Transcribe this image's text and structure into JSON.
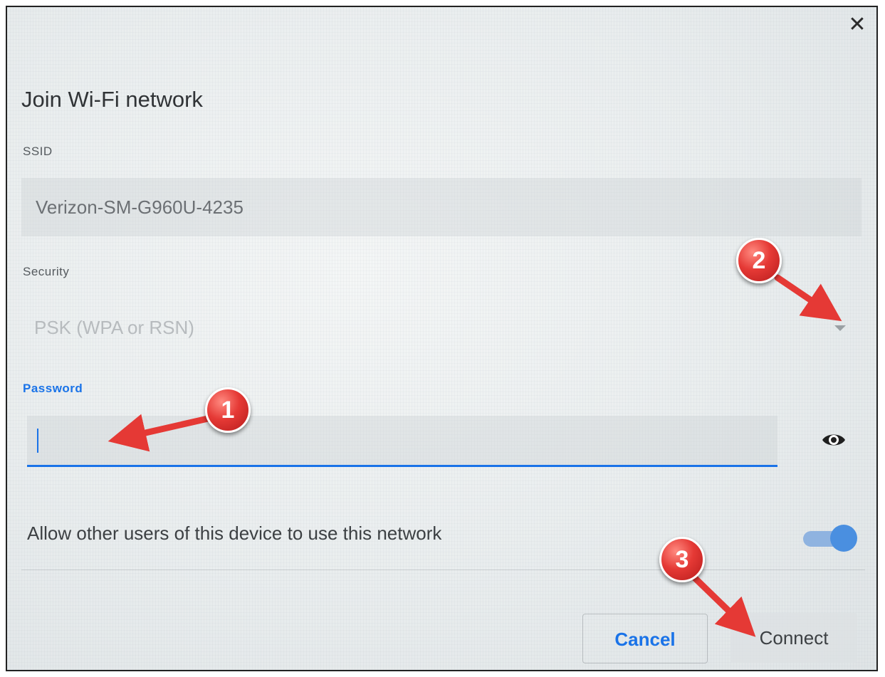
{
  "dialog": {
    "title": "Join Wi-Fi network",
    "close_symbol": "✕"
  },
  "ssid": {
    "label": "SSID",
    "value": "Verizon-SM-G960U-4235"
  },
  "security": {
    "label": "Security",
    "selected": "PSK (WPA or RSN)"
  },
  "password": {
    "label": "Password",
    "value": ""
  },
  "share": {
    "label": "Allow other users of this device to use this network",
    "enabled": true
  },
  "actions": {
    "cancel_label": "Cancel",
    "connect_label": "Connect"
  },
  "annotations": [
    "1",
    "2",
    "3"
  ],
  "colors": {
    "accent": "#1a73e8",
    "annotation_red": "#e53935"
  },
  "icons": {
    "close": "close-icon",
    "show_password": "eye-icon",
    "dropdown": "chevron-down-icon"
  }
}
